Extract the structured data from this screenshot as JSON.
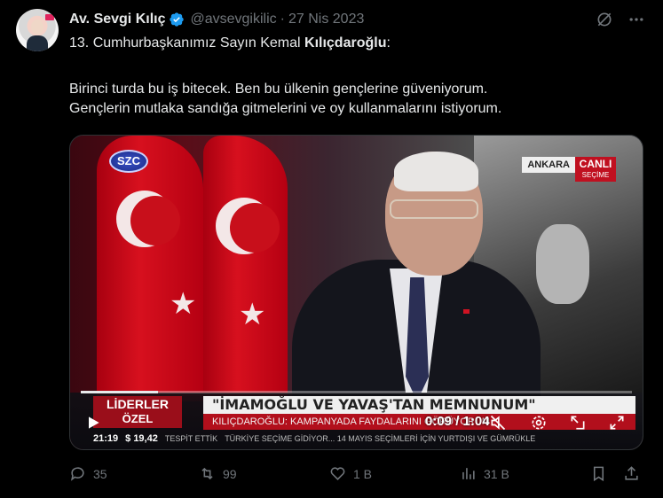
{
  "tweet": {
    "author_name": "Av. Sevgi Kılıç",
    "handle": "@avsevgikilic",
    "separator": "·",
    "date": "27 Nis 2023",
    "line1_prefix": "13. Cumhurbaşkanımız Sayın Kemal ",
    "line1_bold": "Kılıçdaroğlu",
    "line1_suffix": ":",
    "para2_line1": "Birinci turda bu iş bitecek. Ben bu ülkenin gençlerine güveniyorum.",
    "para2_line2": "Gençlerin mutlaka sandığa gitmelerini ve oy kullanmalarını istiyorum."
  },
  "video": {
    "channel_logo": "SZC",
    "location_tag": "ANKARA",
    "live_label": "CANLI",
    "live_sub": "SEÇİME",
    "program_line1": "LİDERLER",
    "program_line2": "ÖZEL",
    "headline": "\"İMAMOĞLU VE YAVAŞ'TAN MEMNUNUM\"",
    "subheadline": "KILIÇDAROĞLU: KAMPANYADA FAYDALARINI GÖRÜYORUM",
    "ticker_time": "21:19",
    "ticker_currency": "$ 19,42",
    "ticker_text1": "TESPİT ETTİK",
    "ticker_text2": "TÜRKİYE SEÇİME GİDİYOR... 14 MAYIS SEÇİMLERİ İÇİN YURTDIŞI VE GÜMRÜKLE",
    "timecode": "0:09 / 1:04",
    "progress": 0.14,
    "icons": [
      "play-icon",
      "mute-icon",
      "settings-icon",
      "pip-icon",
      "fullscreen-icon"
    ]
  },
  "actions": {
    "replies": "35",
    "reposts": "99",
    "likes": "1 B",
    "views": "31 B"
  },
  "colors": {
    "verified": "#1d9bf0",
    "muted_text": "#71767b",
    "text": "#e7e9ea",
    "background": "#000000"
  }
}
